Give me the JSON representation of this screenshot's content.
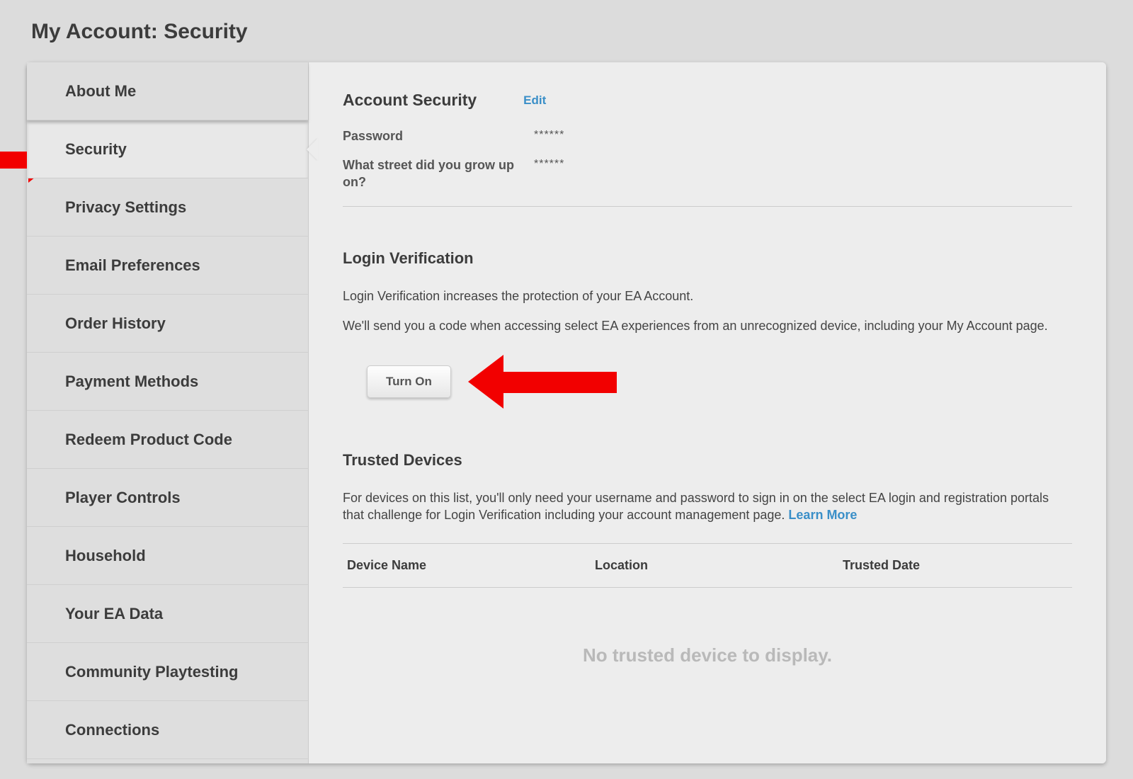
{
  "page": {
    "title": "My Account: Security"
  },
  "sidebar": {
    "items": [
      {
        "label": "About Me"
      },
      {
        "label": "Security"
      },
      {
        "label": "Privacy Settings"
      },
      {
        "label": "Email Preferences"
      },
      {
        "label": "Order History"
      },
      {
        "label": "Payment Methods"
      },
      {
        "label": "Redeem Product Code"
      },
      {
        "label": "Player Controls"
      },
      {
        "label": "Household"
      },
      {
        "label": "Your EA Data"
      },
      {
        "label": "Community Playtesting"
      },
      {
        "label": "Connections"
      }
    ],
    "active_index": 1
  },
  "account_security": {
    "heading": "Account Security",
    "edit_label": "Edit",
    "password_label": "Password",
    "password_value": "******",
    "question_label": "What street did you grow up on?",
    "question_value": "******"
  },
  "login_verification": {
    "heading": "Login Verification",
    "line1": "Login Verification increases the protection of your EA Account.",
    "line2": "We'll send you a code when accessing select EA experiences from an unrecognized device, including your My Account page.",
    "button_label": "Turn On"
  },
  "trusted_devices": {
    "heading": "Trusted Devices",
    "description": "For devices on this list, you'll only need your username and password to sign in on the select EA login and registration portals that challenge for Login Verification including your account management page.  ",
    "learn_more_label": "Learn More",
    "columns": {
      "device": "Device Name",
      "location": "Location",
      "date": "Trusted Date"
    },
    "empty_message": "No trusted device to display."
  },
  "colors": {
    "link": "#3a8fc8",
    "arrow": "#f20000"
  }
}
